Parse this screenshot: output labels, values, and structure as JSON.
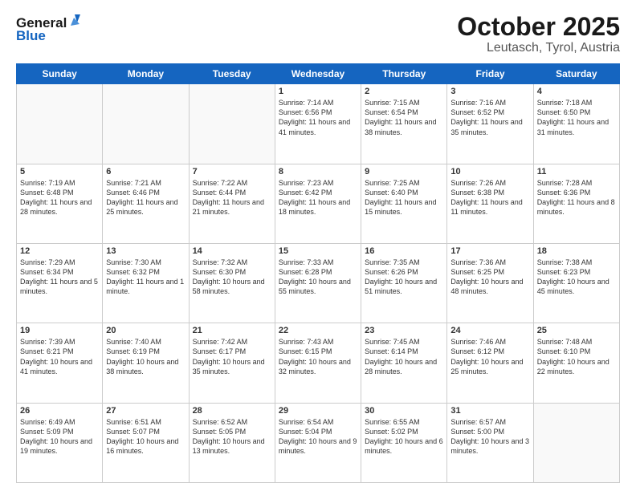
{
  "header": {
    "logo_general": "General",
    "logo_blue": "Blue",
    "month": "October 2025",
    "location": "Leutasch, Tyrol, Austria"
  },
  "weekdays": [
    "Sunday",
    "Monday",
    "Tuesday",
    "Wednesday",
    "Thursday",
    "Friday",
    "Saturday"
  ],
  "weeks": [
    [
      {
        "num": "",
        "info": ""
      },
      {
        "num": "",
        "info": ""
      },
      {
        "num": "",
        "info": ""
      },
      {
        "num": "1",
        "info": "Sunrise: 7:14 AM\nSunset: 6:56 PM\nDaylight: 11 hours and 41 minutes."
      },
      {
        "num": "2",
        "info": "Sunrise: 7:15 AM\nSunset: 6:54 PM\nDaylight: 11 hours and 38 minutes."
      },
      {
        "num": "3",
        "info": "Sunrise: 7:16 AM\nSunset: 6:52 PM\nDaylight: 11 hours and 35 minutes."
      },
      {
        "num": "4",
        "info": "Sunrise: 7:18 AM\nSunset: 6:50 PM\nDaylight: 11 hours and 31 minutes."
      }
    ],
    [
      {
        "num": "5",
        "info": "Sunrise: 7:19 AM\nSunset: 6:48 PM\nDaylight: 11 hours and 28 minutes."
      },
      {
        "num": "6",
        "info": "Sunrise: 7:21 AM\nSunset: 6:46 PM\nDaylight: 11 hours and 25 minutes."
      },
      {
        "num": "7",
        "info": "Sunrise: 7:22 AM\nSunset: 6:44 PM\nDaylight: 11 hours and 21 minutes."
      },
      {
        "num": "8",
        "info": "Sunrise: 7:23 AM\nSunset: 6:42 PM\nDaylight: 11 hours and 18 minutes."
      },
      {
        "num": "9",
        "info": "Sunrise: 7:25 AM\nSunset: 6:40 PM\nDaylight: 11 hours and 15 minutes."
      },
      {
        "num": "10",
        "info": "Sunrise: 7:26 AM\nSunset: 6:38 PM\nDaylight: 11 hours and 11 minutes."
      },
      {
        "num": "11",
        "info": "Sunrise: 7:28 AM\nSunset: 6:36 PM\nDaylight: 11 hours and 8 minutes."
      }
    ],
    [
      {
        "num": "12",
        "info": "Sunrise: 7:29 AM\nSunset: 6:34 PM\nDaylight: 11 hours and 5 minutes."
      },
      {
        "num": "13",
        "info": "Sunrise: 7:30 AM\nSunset: 6:32 PM\nDaylight: 11 hours and 1 minute."
      },
      {
        "num": "14",
        "info": "Sunrise: 7:32 AM\nSunset: 6:30 PM\nDaylight: 10 hours and 58 minutes."
      },
      {
        "num": "15",
        "info": "Sunrise: 7:33 AM\nSunset: 6:28 PM\nDaylight: 10 hours and 55 minutes."
      },
      {
        "num": "16",
        "info": "Sunrise: 7:35 AM\nSunset: 6:26 PM\nDaylight: 10 hours and 51 minutes."
      },
      {
        "num": "17",
        "info": "Sunrise: 7:36 AM\nSunset: 6:25 PM\nDaylight: 10 hours and 48 minutes."
      },
      {
        "num": "18",
        "info": "Sunrise: 7:38 AM\nSunset: 6:23 PM\nDaylight: 10 hours and 45 minutes."
      }
    ],
    [
      {
        "num": "19",
        "info": "Sunrise: 7:39 AM\nSunset: 6:21 PM\nDaylight: 10 hours and 41 minutes."
      },
      {
        "num": "20",
        "info": "Sunrise: 7:40 AM\nSunset: 6:19 PM\nDaylight: 10 hours and 38 minutes."
      },
      {
        "num": "21",
        "info": "Sunrise: 7:42 AM\nSunset: 6:17 PM\nDaylight: 10 hours and 35 minutes."
      },
      {
        "num": "22",
        "info": "Sunrise: 7:43 AM\nSunset: 6:15 PM\nDaylight: 10 hours and 32 minutes."
      },
      {
        "num": "23",
        "info": "Sunrise: 7:45 AM\nSunset: 6:14 PM\nDaylight: 10 hours and 28 minutes."
      },
      {
        "num": "24",
        "info": "Sunrise: 7:46 AM\nSunset: 6:12 PM\nDaylight: 10 hours and 25 minutes."
      },
      {
        "num": "25",
        "info": "Sunrise: 7:48 AM\nSunset: 6:10 PM\nDaylight: 10 hours and 22 minutes."
      }
    ],
    [
      {
        "num": "26",
        "info": "Sunrise: 6:49 AM\nSunset: 5:09 PM\nDaylight: 10 hours and 19 minutes."
      },
      {
        "num": "27",
        "info": "Sunrise: 6:51 AM\nSunset: 5:07 PM\nDaylight: 10 hours and 16 minutes."
      },
      {
        "num": "28",
        "info": "Sunrise: 6:52 AM\nSunset: 5:05 PM\nDaylight: 10 hours and 13 minutes."
      },
      {
        "num": "29",
        "info": "Sunrise: 6:54 AM\nSunset: 5:04 PM\nDaylight: 10 hours and 9 minutes."
      },
      {
        "num": "30",
        "info": "Sunrise: 6:55 AM\nSunset: 5:02 PM\nDaylight: 10 hours and 6 minutes."
      },
      {
        "num": "31",
        "info": "Sunrise: 6:57 AM\nSunset: 5:00 PM\nDaylight: 10 hours and 3 minutes."
      },
      {
        "num": "",
        "info": ""
      }
    ]
  ]
}
